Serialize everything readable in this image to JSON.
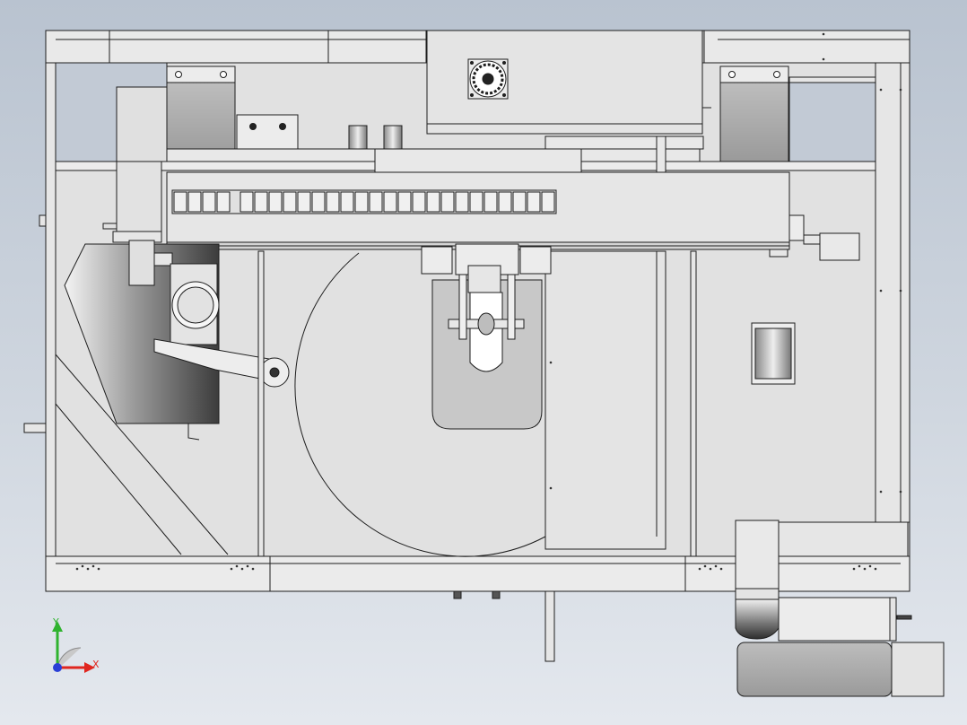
{
  "triad": {
    "y_label": "Y",
    "x_label": "X",
    "y_color": "#2fb32f",
    "x_color": "#e0261f",
    "z_color": "#2a3fd6"
  },
  "palette": {
    "background_top": "#b9c3d0",
    "background_bottom": "#e4e8ee",
    "part_fill": "#e8e8e8",
    "part_dark": "#a9a9a9",
    "edge": "#1e1e1e"
  }
}
